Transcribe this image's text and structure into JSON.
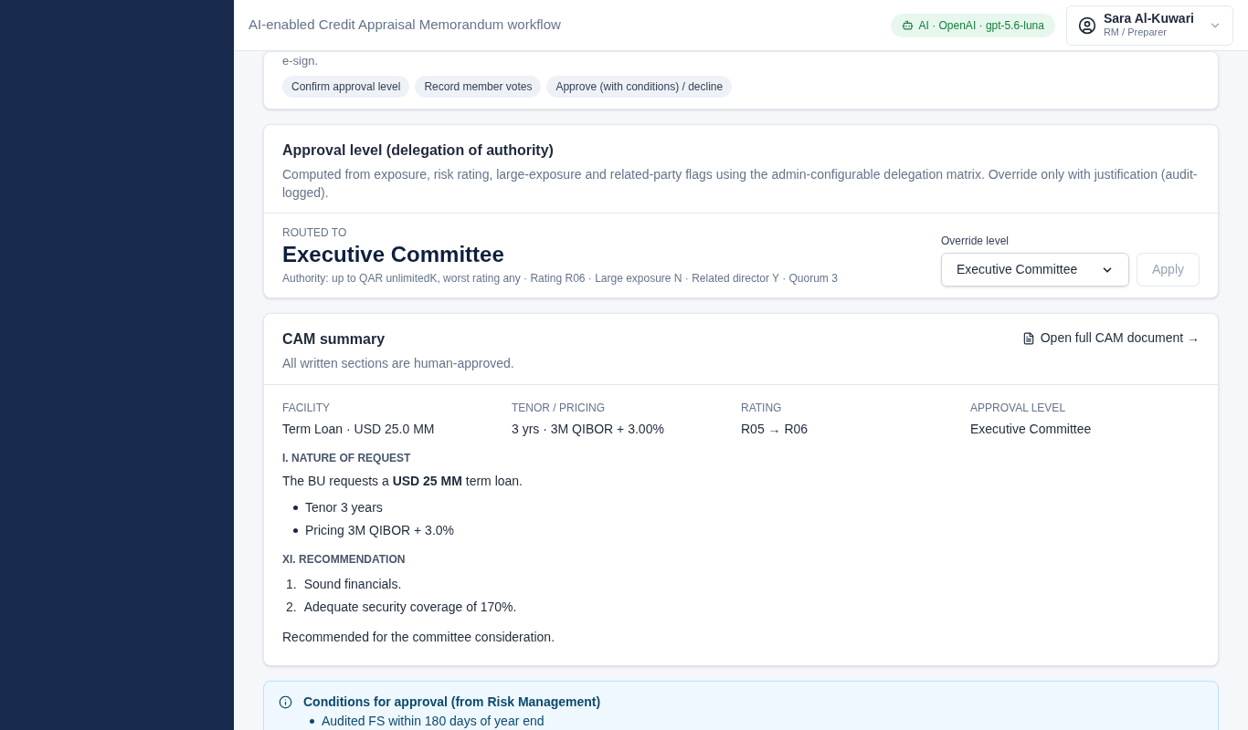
{
  "header": {
    "title": "AI-enabled Credit Appraisal Memorandum workflow",
    "ai_badge": "AI · OpenAI · gpt-5.6-luna",
    "user": {
      "name": "Sara Al-Kuwari",
      "role": "RM / Preparer"
    }
  },
  "steps_card": {
    "text": "e-sign.",
    "chips": [
      "Confirm approval level",
      "Record member votes",
      "Approve (with conditions) / decline"
    ]
  },
  "approval": {
    "title": "Approval level (delegation of authority)",
    "description": "Computed from exposure, risk rating, large-exposure and related-party flags using the admin-configurable delegation matrix. Override only with justification (audit-logged).",
    "routed_label": "ROUTED TO",
    "routed_value": "Executive Committee",
    "authority": "Authority: up to QAR unlimitedK, worst rating any · Rating R06 · Large exposure N · Related director Y · Quorum 3",
    "override_label": "Override level",
    "override_value": "Executive Committee",
    "apply": "Apply",
    "apply_disabled": true
  },
  "cam": {
    "title": "CAM summary",
    "subtitle": "All written sections are human-approved.",
    "open_link": "Open full CAM document →",
    "facts": [
      {
        "label": "FACILITY",
        "value": "Term Loan · USD 25.0 MM"
      },
      {
        "label": "TENOR / PRICING",
        "value": "3 yrs · 3M QIBOR + 3.00%"
      },
      {
        "label": "RATING",
        "value": "R05 → R06"
      },
      {
        "label": "APPROVAL LEVEL",
        "value": "Executive Committee"
      }
    ],
    "sections": [
      {
        "heading": "I. NATURE OF REQUEST",
        "paragraph": "The BU requests a **USD 25 MM** term loan.",
        "kind": "bullet",
        "items": [
          "Tenor 3 years",
          "Pricing 3M QIBOR + 3.0%"
        ]
      },
      {
        "heading": "XI. RECOMMENDATION",
        "kind": "numbered",
        "markers": [
          "1.",
          "2."
        ],
        "items": [
          "Sound financials.",
          "Adequate security coverage of 170%."
        ],
        "closing": "Recommended for the committee consideration."
      }
    ]
  },
  "conditions": {
    "title": "Conditions for approval (from Risk Management)",
    "items": [
      "Audited FS within 180 days of year end"
    ]
  }
}
